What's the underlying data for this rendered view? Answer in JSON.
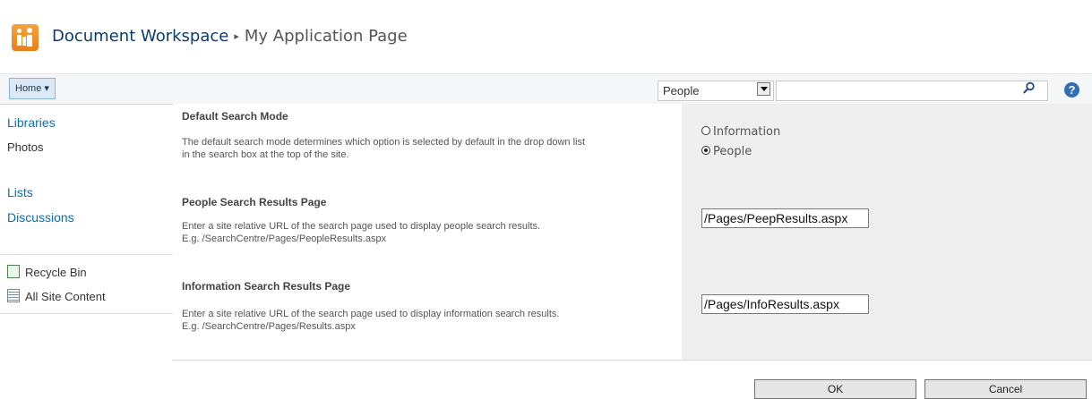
{
  "header": {
    "site_title": "Document Workspace",
    "separator": "▸",
    "page_title": "My Application Page"
  },
  "topbar": {
    "home_label": "Home ▾",
    "scope_value": "People",
    "search_value": "",
    "help_symbol": "?"
  },
  "leftnav": {
    "libraries": "Libraries",
    "photos": "Photos",
    "lists": "Lists",
    "discussions": "Discussions",
    "recycle_bin": "Recycle Bin",
    "all_site_content": "All Site Content"
  },
  "sections": [
    {
      "title": "Default Search Mode",
      "text_line1": "The default search mode determines which option is selected by default in the drop down list",
      "text_line2": "in the search box at the top of the site.",
      "options": [
        {
          "label": "Information",
          "selected": false
        },
        {
          "label": "People",
          "selected": true
        }
      ]
    },
    {
      "title": "People Search Results Page",
      "text_line1": "Enter a site relative URL of the search page used to display people search results.",
      "text_line2": "E.g. /SearchCentre/Pages/PeopleResults.aspx",
      "value": "/Pages/PeepResults.aspx"
    },
    {
      "title": "Information Search Results Page",
      "text_line1": "Enter a site relative URL of the search page used to display information search results.",
      "text_line2": "E.g. /SearchCentre/Pages/Results.aspx",
      "value": "/Pages/InfoResults.aspx"
    }
  ],
  "buttons": {
    "ok": "OK",
    "cancel": "Cancel"
  },
  "icons": [
    "site-logo-icon",
    "search-icon",
    "help-icon",
    "recycle-bin-icon",
    "all-site-content-icon",
    "dropdown-arrow-icon"
  ]
}
